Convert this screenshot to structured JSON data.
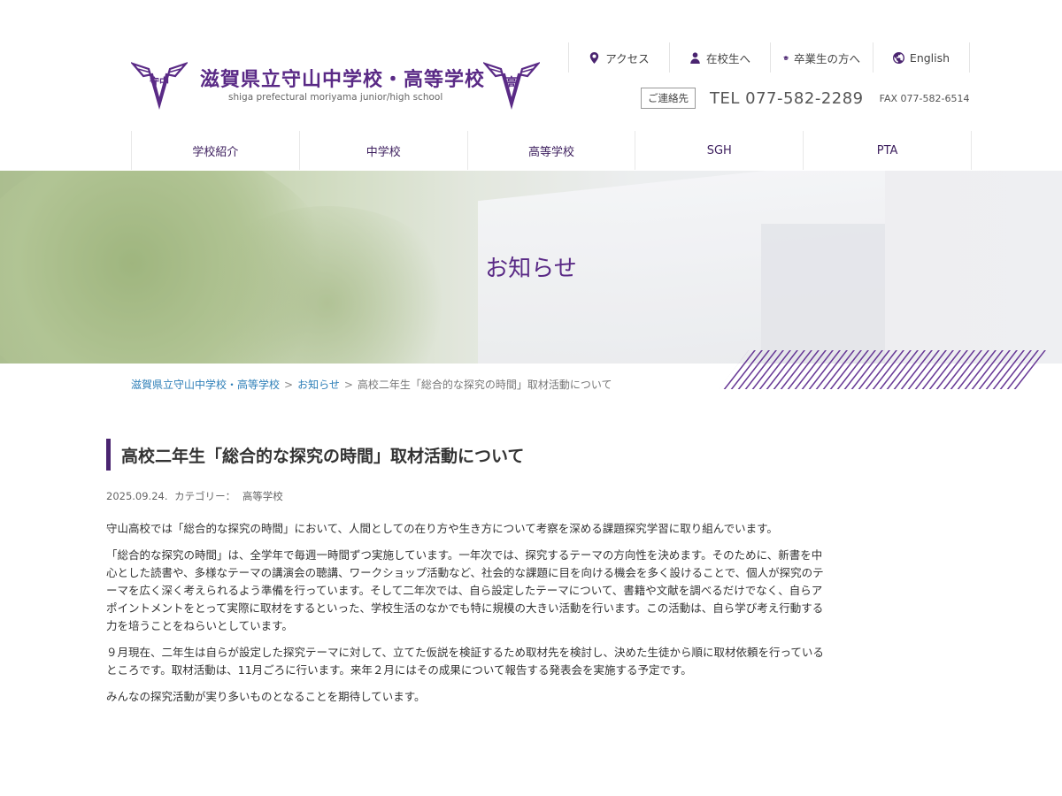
{
  "header": {
    "logo_title": "滋賀県立守山中学校・高等学校",
    "logo_subtitle": "shiga prefectural moriyama junior/high school",
    "emblem_left_text": "守中",
    "emblem_right_text": "高",
    "utility_nav": [
      {
        "label": "アクセス",
        "icon": "map-pin-icon"
      },
      {
        "label": "在校生へ",
        "icon": "person-icon"
      },
      {
        "label": "卒業生の方へ",
        "icon": "graduation-cap-icon"
      },
      {
        "label": "English",
        "icon": "globe-icon"
      }
    ],
    "contact_badge": "ご連絡先",
    "tel": "TEL 077-582-2289",
    "fax": "FAX 077-582-6514"
  },
  "main_nav": [
    "学校紹介",
    "中学校",
    "高等学校",
    "SGH",
    "PTA"
  ],
  "hero": {
    "title": "お知らせ"
  },
  "breadcrumb": {
    "home": "滋賀県立守山中学校・高等学校",
    "section": "お知らせ",
    "current": "高校二年生「総合的な探究の時間」取材活動について",
    "separator": ">"
  },
  "article": {
    "title": "高校二年生「総合的な探究の時間」取材活動について",
    "date": "2025.09.24.",
    "category_label": "カテゴリー：",
    "category": "高等学校",
    "paragraphs": [
      "守山高校では「総合的な探究の時間」において、人間としての在り方や生き方について考察を深める課題探究学習に取り組んでいます。",
      "「総合的な探究の時間」は、全学年で毎週一時間ずつ実施しています。一年次では、探究するテーマの方向性を決めます。そのために、新書を中心とした読書や、多様なテーマの講演会の聴講、ワークショップ活動など、社会的な課題に目を向ける機会を多く設けることで、個人が探究のテーマを広く深く考えられるよう準備を行っています。そして二年次では、自ら設定したテーマについて、書籍や文献を調べるだけでなく、自らアポイントメントをとって実際に取材をするといった、学校生活のなかでも特に規模の大きい活動を行います。この活動は、自ら学び考え行動する力を培うことをねらいとしています。",
      "９月現在、二年生は自らが設定した探究テーマに対して、立てた仮説を検証するため取材先を検討し、決めた生徒から順に取材依頼を行っているところです。取材活動は、11月ごろに行います。来年２月にはその成果について報告する発表会を実施する予定です。",
      "みんなの探究活動が実り多いものとなることを期待しています。"
    ]
  },
  "colors": {
    "brand": "#5a2a86",
    "link": "#2e7fb8"
  }
}
